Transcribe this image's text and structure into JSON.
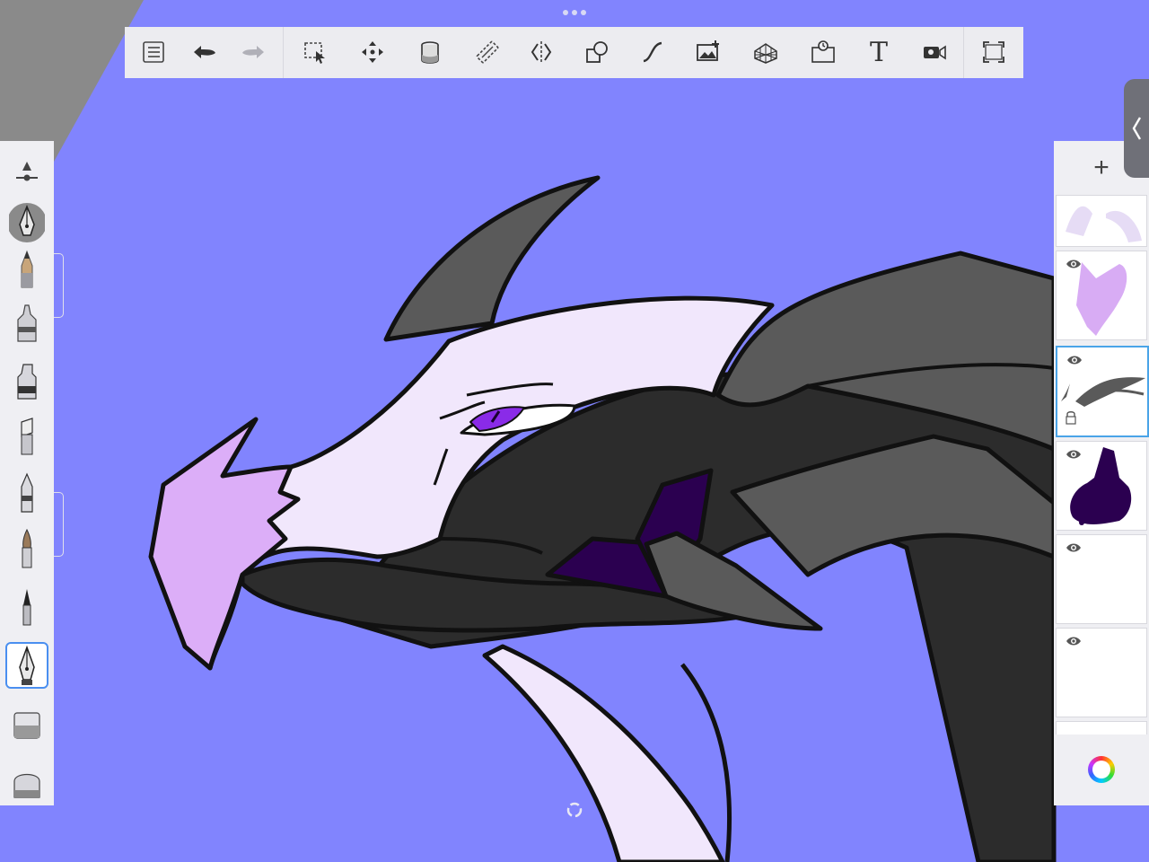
{
  "app": {
    "canvas_background": "#8184fe",
    "accent": "#4a8ff0"
  },
  "toolbar": {
    "items": [
      {
        "name": "gallery",
        "icon": "list-icon"
      },
      {
        "name": "undo",
        "icon": "undo-icon"
      },
      {
        "name": "redo",
        "icon": "redo-icon"
      },
      {
        "name": "selection",
        "icon": "selection-icon"
      },
      {
        "name": "transform",
        "icon": "move-icon"
      },
      {
        "name": "fill",
        "icon": "paint-bucket-icon"
      },
      {
        "name": "ruler",
        "icon": "ruler-icon"
      },
      {
        "name": "symmetry",
        "icon": "symmetry-icon"
      },
      {
        "name": "shapes",
        "icon": "shapes-icon"
      },
      {
        "name": "curve",
        "icon": "curve-icon"
      },
      {
        "name": "image",
        "icon": "image-add-icon"
      },
      {
        "name": "perspective",
        "icon": "perspective-grid-icon"
      },
      {
        "name": "time-lapse",
        "icon": "timelapse-icon"
      },
      {
        "name": "text",
        "icon": "text-icon",
        "label": "T"
      },
      {
        "name": "record",
        "icon": "video-icon"
      },
      {
        "name": "fullscreen",
        "icon": "fullscreen-icon"
      }
    ]
  },
  "brushes": {
    "items": [
      {
        "name": "brush-settings",
        "icon": "brush-settings-icon"
      },
      {
        "name": "pen-current",
        "icon": "pen-nib-icon"
      },
      {
        "name": "pencil",
        "icon": "pencil-icon"
      },
      {
        "name": "airbrush",
        "icon": "airbrush-icon"
      },
      {
        "name": "marker",
        "icon": "marker-icon"
      },
      {
        "name": "chisel",
        "icon": "chisel-icon"
      },
      {
        "name": "ballpoint",
        "icon": "ballpoint-icon"
      },
      {
        "name": "paint-brush",
        "icon": "paintbrush-icon"
      },
      {
        "name": "fine-brush",
        "icon": "fine-brush-icon"
      },
      {
        "name": "inking-pen",
        "icon": "inking-pen-icon",
        "selected": true
      },
      {
        "name": "eraser",
        "icon": "eraser-icon"
      },
      {
        "name": "smudge",
        "icon": "smudge-icon"
      }
    ]
  },
  "layers": {
    "add_label": "+",
    "items": [
      {
        "name": "layer-face-highlights",
        "visible": true
      },
      {
        "name": "layer-beak-lilac",
        "visible": true
      },
      {
        "name": "layer-horns-gray",
        "visible": true,
        "active": true,
        "locked": true
      },
      {
        "name": "layer-purple-scales",
        "visible": true
      },
      {
        "name": "layer-empty-1",
        "visible": true
      },
      {
        "name": "layer-empty-2",
        "visible": true
      }
    ]
  },
  "colors": {
    "outline": "#111111",
    "face": "#f1e7fc",
    "beak": "#dcaef8",
    "horn": "#5a5a5a",
    "neck": "#2c2c2c",
    "eye": "#8a2be8",
    "scale": "#2b0050"
  }
}
